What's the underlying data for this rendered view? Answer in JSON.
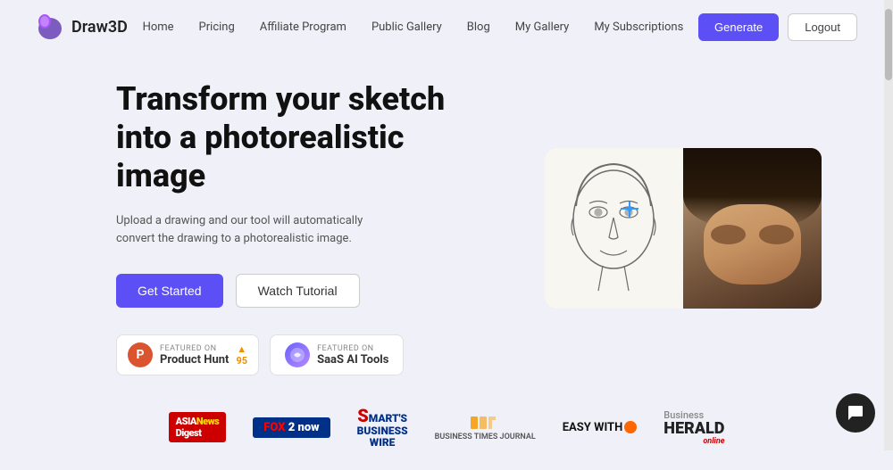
{
  "header": {
    "logo_text": "Draw3D",
    "nav": {
      "home": "Home",
      "pricing": "Pricing",
      "affiliate": "Affiliate Program",
      "gallery": "Public Gallery",
      "blog": "Blog",
      "my_gallery": "My Gallery",
      "subscriptions": "My Subscriptions"
    },
    "generate_btn": "Generate",
    "logout_btn": "Logout"
  },
  "hero": {
    "title": "Transform your sketch into a photorealistic image",
    "subtitle": "Upload a drawing and our tool will automatically convert the drawing to a photorealistic image.",
    "get_started_btn": "Get Started",
    "watch_tutorial_btn": "Watch Tutorial"
  },
  "badges": {
    "ph_featured_label": "FEATURED ON",
    "ph_name": "Product Hunt",
    "ph_score": "95",
    "ph_score_arrow": "▲",
    "saas_featured_label": "Featured on",
    "saas_name": "SaaS AI Tools"
  },
  "media": {
    "logos": [
      {
        "id": "asia",
        "label": "ASIA News Digest"
      },
      {
        "id": "fox",
        "label": "FOX 2 now"
      },
      {
        "id": "sbw",
        "label": "SMART'S BUSINESS WIRE"
      },
      {
        "id": "btj",
        "label": "BUSINESS TIMES JOURNAL"
      },
      {
        "id": "easy",
        "label": "EASY WITH"
      },
      {
        "id": "herald",
        "label": "Business HERALD online"
      }
    ]
  },
  "colors": {
    "accent": "#5b4ff5",
    "ph_orange": "#da552f"
  }
}
